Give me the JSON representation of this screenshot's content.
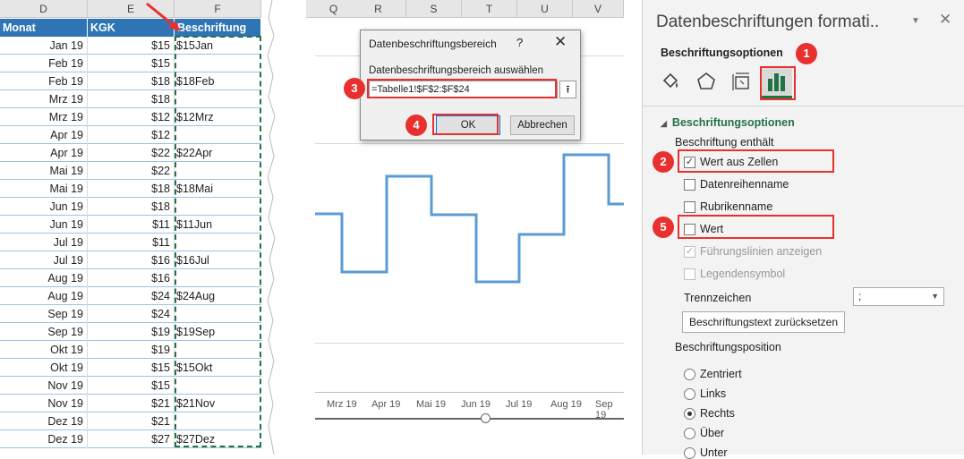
{
  "sheet": {
    "col_headers": [
      "D",
      "E",
      "F"
    ],
    "table_headers": [
      "Monat",
      "KGK",
      "Beschriftung"
    ],
    "rows": [
      {
        "monat": "Jan 19",
        "kgk": "$15",
        "label": "$15Jan"
      },
      {
        "monat": "Feb 19",
        "kgk": "$15",
        "label": ""
      },
      {
        "monat": "Feb 19",
        "kgk": "$18",
        "label": "$18Feb"
      },
      {
        "monat": "Mrz 19",
        "kgk": "$18",
        "label": ""
      },
      {
        "monat": "Mrz 19",
        "kgk": "$12",
        "label": "$12Mrz"
      },
      {
        "monat": "Apr 19",
        "kgk": "$12",
        "label": ""
      },
      {
        "monat": "Apr 19",
        "kgk": "$22",
        "label": "$22Apr"
      },
      {
        "monat": "Mai 19",
        "kgk": "$22",
        "label": ""
      },
      {
        "monat": "Mai 19",
        "kgk": "$18",
        "label": "$18Mai"
      },
      {
        "monat": "Jun 19",
        "kgk": "$18",
        "label": ""
      },
      {
        "monat": "Jun 19",
        "kgk": "$11",
        "label": "$11Jun"
      },
      {
        "monat": "Jul 19",
        "kgk": "$11",
        "label": ""
      },
      {
        "monat": "Jul 19",
        "kgk": "$16",
        "label": "$16Jul"
      },
      {
        "monat": "Aug 19",
        "kgk": "$16",
        "label": ""
      },
      {
        "monat": "Aug 19",
        "kgk": "$24",
        "label": "$24Aug"
      },
      {
        "monat": "Sep 19",
        "kgk": "$24",
        "label": ""
      },
      {
        "monat": "Sep 19",
        "kgk": "$19",
        "label": "$19Sep"
      },
      {
        "monat": "Okt 19",
        "kgk": "$19",
        "label": ""
      },
      {
        "monat": "Okt 19",
        "kgk": "$15",
        "label": "$15Okt"
      },
      {
        "monat": "Nov 19",
        "kgk": "$15",
        "label": ""
      },
      {
        "monat": "Nov 19",
        "kgk": "$21",
        "label": "$21Nov"
      },
      {
        "monat": "Dez 19",
        "kgk": "$21",
        "label": ""
      },
      {
        "monat": "Dez 19",
        "kgk": "$27",
        "label": "$27Dez"
      }
    ]
  },
  "chart_area": {
    "col_headers": [
      "Q",
      "R",
      "S",
      "T",
      "U",
      "V"
    ],
    "x_labels": [
      "Mrz 19",
      "Apr 19",
      "Mai 19",
      "Jun 19",
      "Jul 19",
      "Aug 19",
      "Sep 19"
    ],
    "line_color": "#5b9bd5"
  },
  "dialog": {
    "title": "Datenbeschriftungsbereich",
    "help": "?",
    "close": "✕",
    "prompt": "Datenbeschriftungsbereich auswählen",
    "range_value": "=Tabelle1!$F$2:$F$24",
    "collapse_icon": "⭱",
    "ok_label": "OK",
    "cancel_label": "Abbrechen"
  },
  "pane": {
    "title": "Datenbeschriftungen formati..",
    "dropdown_icon": "▼",
    "close_icon": "✕",
    "subtitle": "Beschriftungsoptionen",
    "section": "Beschriftungsoptionen",
    "contains_label": "Beschriftung enthält",
    "options": [
      {
        "label": "Wert aus Zellen",
        "checked": true,
        "disabled": false
      },
      {
        "label": "Datenreihenname",
        "checked": false,
        "disabled": false
      },
      {
        "label": "Rubrikenname",
        "checked": false,
        "disabled": false
      },
      {
        "label": "Wert",
        "checked": false,
        "disabled": false
      },
      {
        "label": "Führungslinien anzeigen",
        "checked": true,
        "disabled": true
      },
      {
        "label": "Legendensymbol",
        "checked": false,
        "disabled": true
      }
    ],
    "separator_label": "Trennzeichen",
    "separator_value": ";",
    "reset_button": "Beschriftungstext zurücksetzen",
    "position_label": "Beschriftungsposition",
    "positions": [
      {
        "label": "Zentriert",
        "selected": false
      },
      {
        "label": "Links",
        "selected": false
      },
      {
        "label": "Rechts",
        "selected": true
      },
      {
        "label": "Über",
        "selected": false
      },
      {
        "label": "Unter",
        "selected": false
      }
    ]
  },
  "callouts": [
    "1",
    "2",
    "3",
    "4",
    "5"
  ],
  "accent": "#e8312f"
}
